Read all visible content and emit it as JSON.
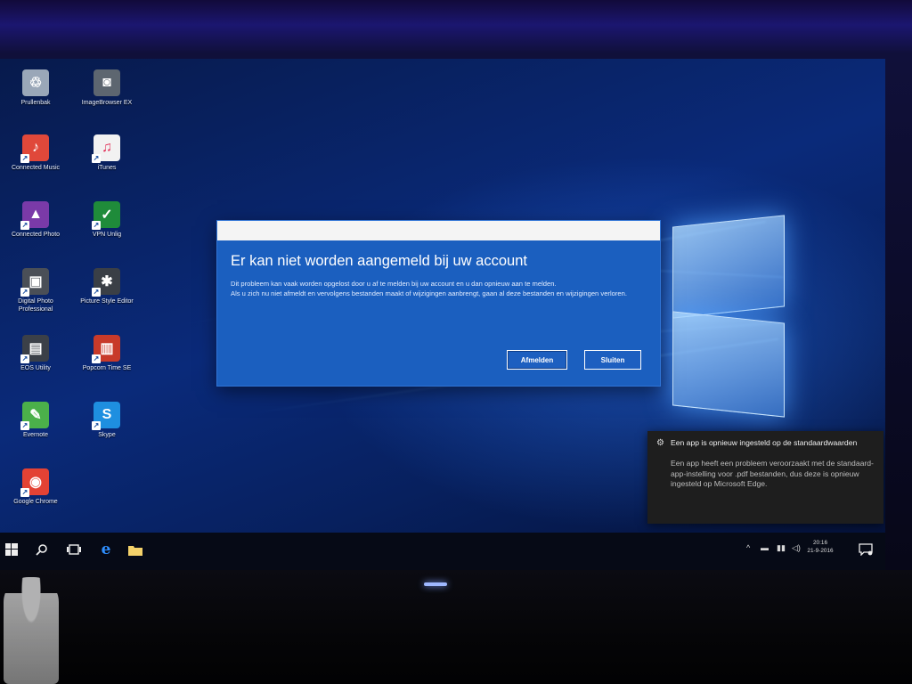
{
  "desktop": {
    "icons": [
      {
        "label": "Prullenbak",
        "icon": "recycle-bin-icon",
        "color": "#9aa7b8"
      },
      {
        "label": "ImageBrowser EX",
        "icon": "camera-icon",
        "color": "#5d6670"
      },
      {
        "label": "Connected Music",
        "icon": "music-folder-icon",
        "color": "#e0483a"
      },
      {
        "label": "iTunes",
        "icon": "itunes-icon",
        "color": "#f2f2f2"
      },
      {
        "label": "Connected Photo",
        "icon": "photo-app-icon",
        "color": "#7a3aa8"
      },
      {
        "label": "VPN Unlig",
        "icon": "shield-icon",
        "color": "#1f8b3a"
      },
      {
        "label": "Digital Photo Professional",
        "icon": "photo-professional-icon",
        "color": "#4a4f57"
      },
      {
        "label": "Picture Style Editor",
        "icon": "picture-style-icon",
        "color": "#3a3f46"
      },
      {
        "label": "EOS Utility",
        "icon": "eos-utility-icon",
        "color": "#3b4048"
      },
      {
        "label": "Popcorn Time SE",
        "icon": "popcorn-icon",
        "color": "#c83a2a"
      },
      {
        "label": "Evernote",
        "icon": "evernote-icon",
        "color": "#4bb04a"
      },
      {
        "label": "Skype",
        "icon": "skype-icon",
        "color": "#1e8fe0"
      },
      {
        "label": "Google Chrome",
        "icon": "chrome-icon",
        "color": "#e34234"
      }
    ]
  },
  "dialog": {
    "title": "Er kan niet worden aangemeld bij uw account",
    "body_1": "Dit probleem kan vaak worden opgelost door u af te melden bij uw account en u dan opnieuw aan te melden.",
    "body_2": "Als u zich nu niet afmeldt en vervolgens bestanden maakt of wijzigingen aanbrengt, gaan al deze bestanden en wijzigingen verloren.",
    "primary_label": "Afmelden",
    "secondary_label": "Sluiten"
  },
  "toast": {
    "title": "Een app is opnieuw ingesteld op de standaardwaarden",
    "body": "Een app heeft een probleem veroorzaakt met de standaard-app-instelling voor .pdf bestanden, dus deze is opnieuw ingesteld op Microsoft Edge."
  },
  "taskbar": {
    "items": [
      "start-icon",
      "search-icon",
      "task-view-icon",
      "edge-icon",
      "file-explorer-icon"
    ],
    "time": "20:16",
    "date": "21-9-2016"
  },
  "colors": {
    "accent": "#1b5fbf",
    "taskbar": "#060a16",
    "toast_bg": "#1e1e1e"
  }
}
